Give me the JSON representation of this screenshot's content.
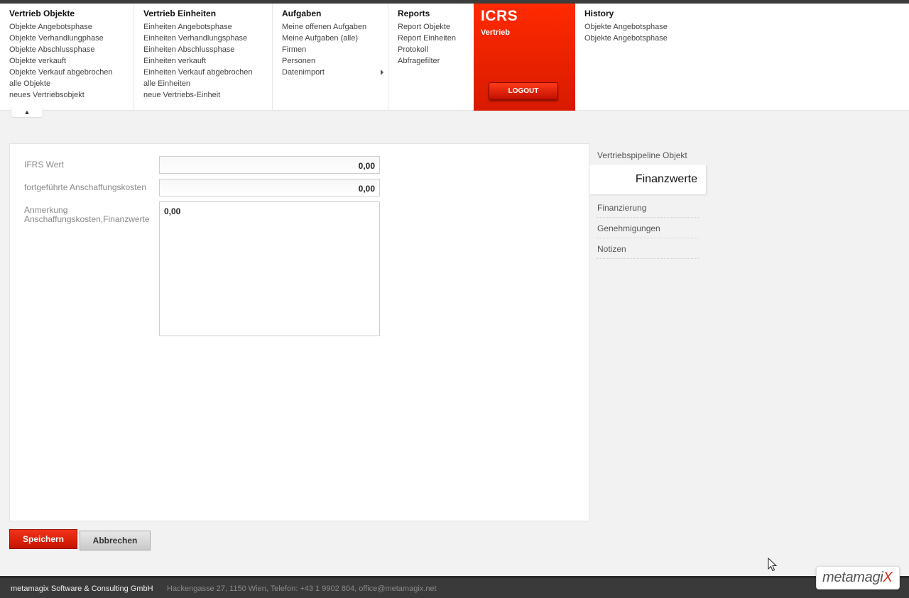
{
  "nav": {
    "columns": [
      {
        "title": "Vertrieb Objekte",
        "items": [
          "Objekte Angebotsphase",
          "Objekte Verhandlungphase",
          "Objekte Abschlussphase",
          "Objekte verkauft",
          "Objekte Verkauf abgebrochen",
          "alle Objekte",
          "neues Vertriebsobjekt"
        ]
      },
      {
        "title": "Vertrieb Einheiten",
        "items": [
          "Einheiten Angebotsphase",
          "Einheiten Verhandlungsphase",
          "Einheiten Abschlussphase",
          "Einheiten verkauft",
          "Einheiten Verkauf abgebrochen",
          "alle Einheiten",
          "neue Vertriebs-Einheit"
        ]
      },
      {
        "title": "Aufgaben",
        "items": [
          "Meine offenen Aufgaben",
          "Meine Aufgaben (alle)",
          "Firmen",
          "Personen",
          "Datenimport"
        ]
      },
      {
        "title": "Reports",
        "items": [
          "Report Objekte",
          "Report Einheiten",
          "Protokoll",
          "Abfragefilter"
        ]
      }
    ],
    "brand": {
      "name": "ICRS",
      "subtitle": "Vertrieb",
      "logout_label": "LOGOUT"
    },
    "history": {
      "title": "History",
      "items": [
        "Objekte Angebotsphase",
        "Objekte Angebotsphase"
      ]
    },
    "collapse_icon": "arrow-up-icon"
  },
  "form": {
    "ifrs_label": "IFRS Wert",
    "ifrs_value": "0,00",
    "ak_label": "fortgeführte Anschaffungskosten",
    "ak_value": "0,00",
    "note_label_line1": "Anmerkung",
    "note_label_line2": "Anschaffungskosten,Finanzwerte",
    "note_value": "0,00"
  },
  "side_tabs": {
    "items": [
      "Vertriebspipeline Objekt",
      "Finanzwerte",
      "Finanzierung",
      "Genehmigungen",
      "Notizen"
    ],
    "active": "Finanzwerte"
  },
  "buttons": {
    "save_label": "Speichern",
    "cancel_label": "Abbrechen"
  },
  "footer": {
    "company": "metamagix Software & Consulting GmbH",
    "address": "Hackengasse 27, 1150 Wien, Telefon: +43 1 9902 804, office@metamagix.net",
    "logo_text": "metamagi",
    "logo_accent": "X"
  },
  "colors": {
    "accent": "#e0301e",
    "brand_red": "#ff2a00",
    "footer_bg": "#3a3a3a"
  }
}
